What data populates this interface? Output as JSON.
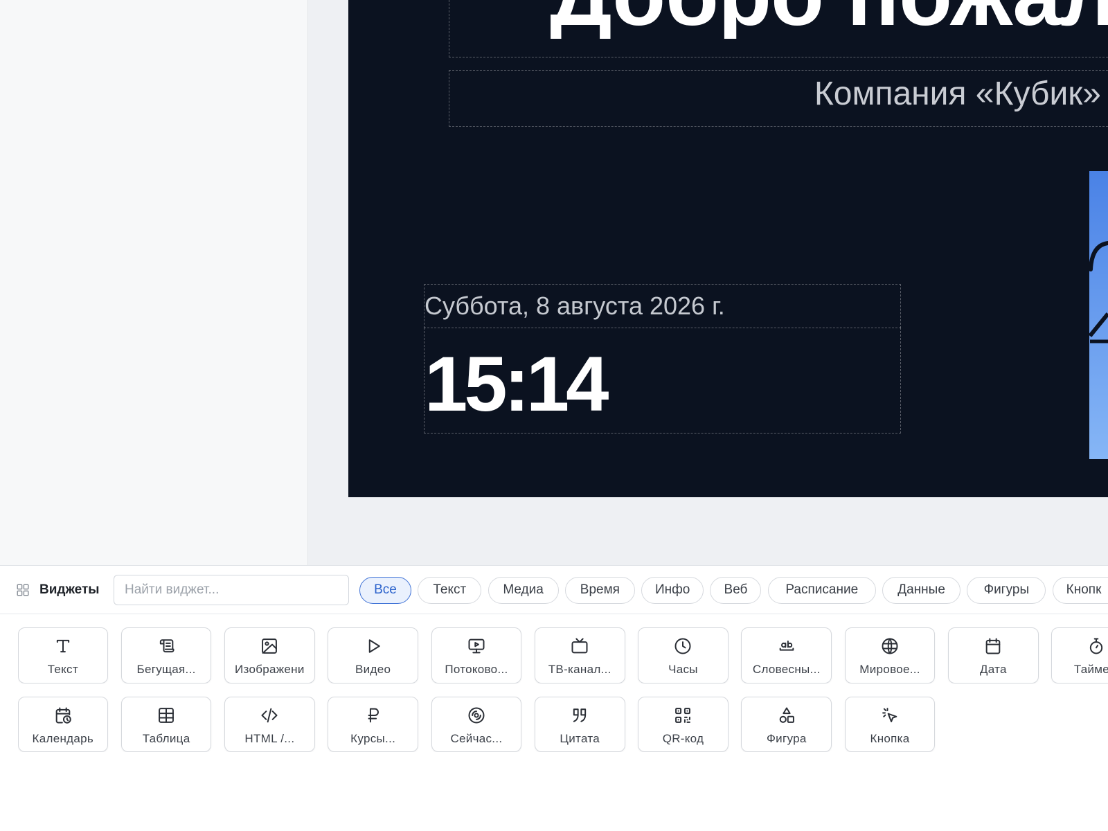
{
  "slide": {
    "title": "Добро пожал",
    "subtitle": "Компания «Кубик»",
    "date": "Суббота, 8 августа 2026 г.",
    "time": "15:14"
  },
  "widgets_panel": {
    "title": "Виджеты",
    "title_icon": "widgets-grid-icon",
    "search_placeholder": "Найти виджет...",
    "filters": [
      {
        "label": "Все",
        "active": true
      },
      {
        "label": "Текст",
        "active": false
      },
      {
        "label": "Медиа",
        "active": false
      },
      {
        "label": "Время",
        "active": false
      },
      {
        "label": "Инфо",
        "active": false
      },
      {
        "label": "Веб",
        "active": false
      },
      {
        "label": "Расписание",
        "active": false
      },
      {
        "label": "Данные",
        "active": false
      },
      {
        "label": "Фигуры",
        "active": false
      },
      {
        "label": "Кнопк",
        "active": false
      }
    ],
    "widgets": [
      {
        "label": "Текст",
        "icon": "text-icon"
      },
      {
        "label": "Бегущая...",
        "icon": "ticker-icon"
      },
      {
        "label": "Изображени",
        "icon": "image-icon"
      },
      {
        "label": "Видео",
        "icon": "video-icon"
      },
      {
        "label": "Потоково...",
        "icon": "stream-icon"
      },
      {
        "label": "ТВ-канал...",
        "icon": "tv-icon"
      },
      {
        "label": "Часы",
        "icon": "clock-icon"
      },
      {
        "label": "Словесны...",
        "icon": "word-clock-icon"
      },
      {
        "label": "Мировое...",
        "icon": "globe-icon"
      },
      {
        "label": "Дата",
        "icon": "date-icon"
      },
      {
        "label": "Тайме",
        "icon": "timer-icon"
      },
      {
        "label": "Календарь",
        "icon": "calendar-icon"
      },
      {
        "label": "Таблица",
        "icon": "table-icon"
      },
      {
        "label": "HTML /...",
        "icon": "code-icon"
      },
      {
        "label": "Курсы...",
        "icon": "ruble-icon"
      },
      {
        "label": "Сейчас...",
        "icon": "now-playing-icon"
      },
      {
        "label": "Цитата",
        "icon": "quote-icon"
      },
      {
        "label": "QR-код",
        "icon": "qr-code-icon"
      },
      {
        "label": "Фигура",
        "icon": "shapes-icon"
      },
      {
        "label": "Кнопка",
        "icon": "cursor-click-icon"
      }
    ]
  },
  "colors": {
    "accent": "#2c63cc",
    "slide_background": "#0b1220",
    "slide_image": "#5b8fea"
  }
}
